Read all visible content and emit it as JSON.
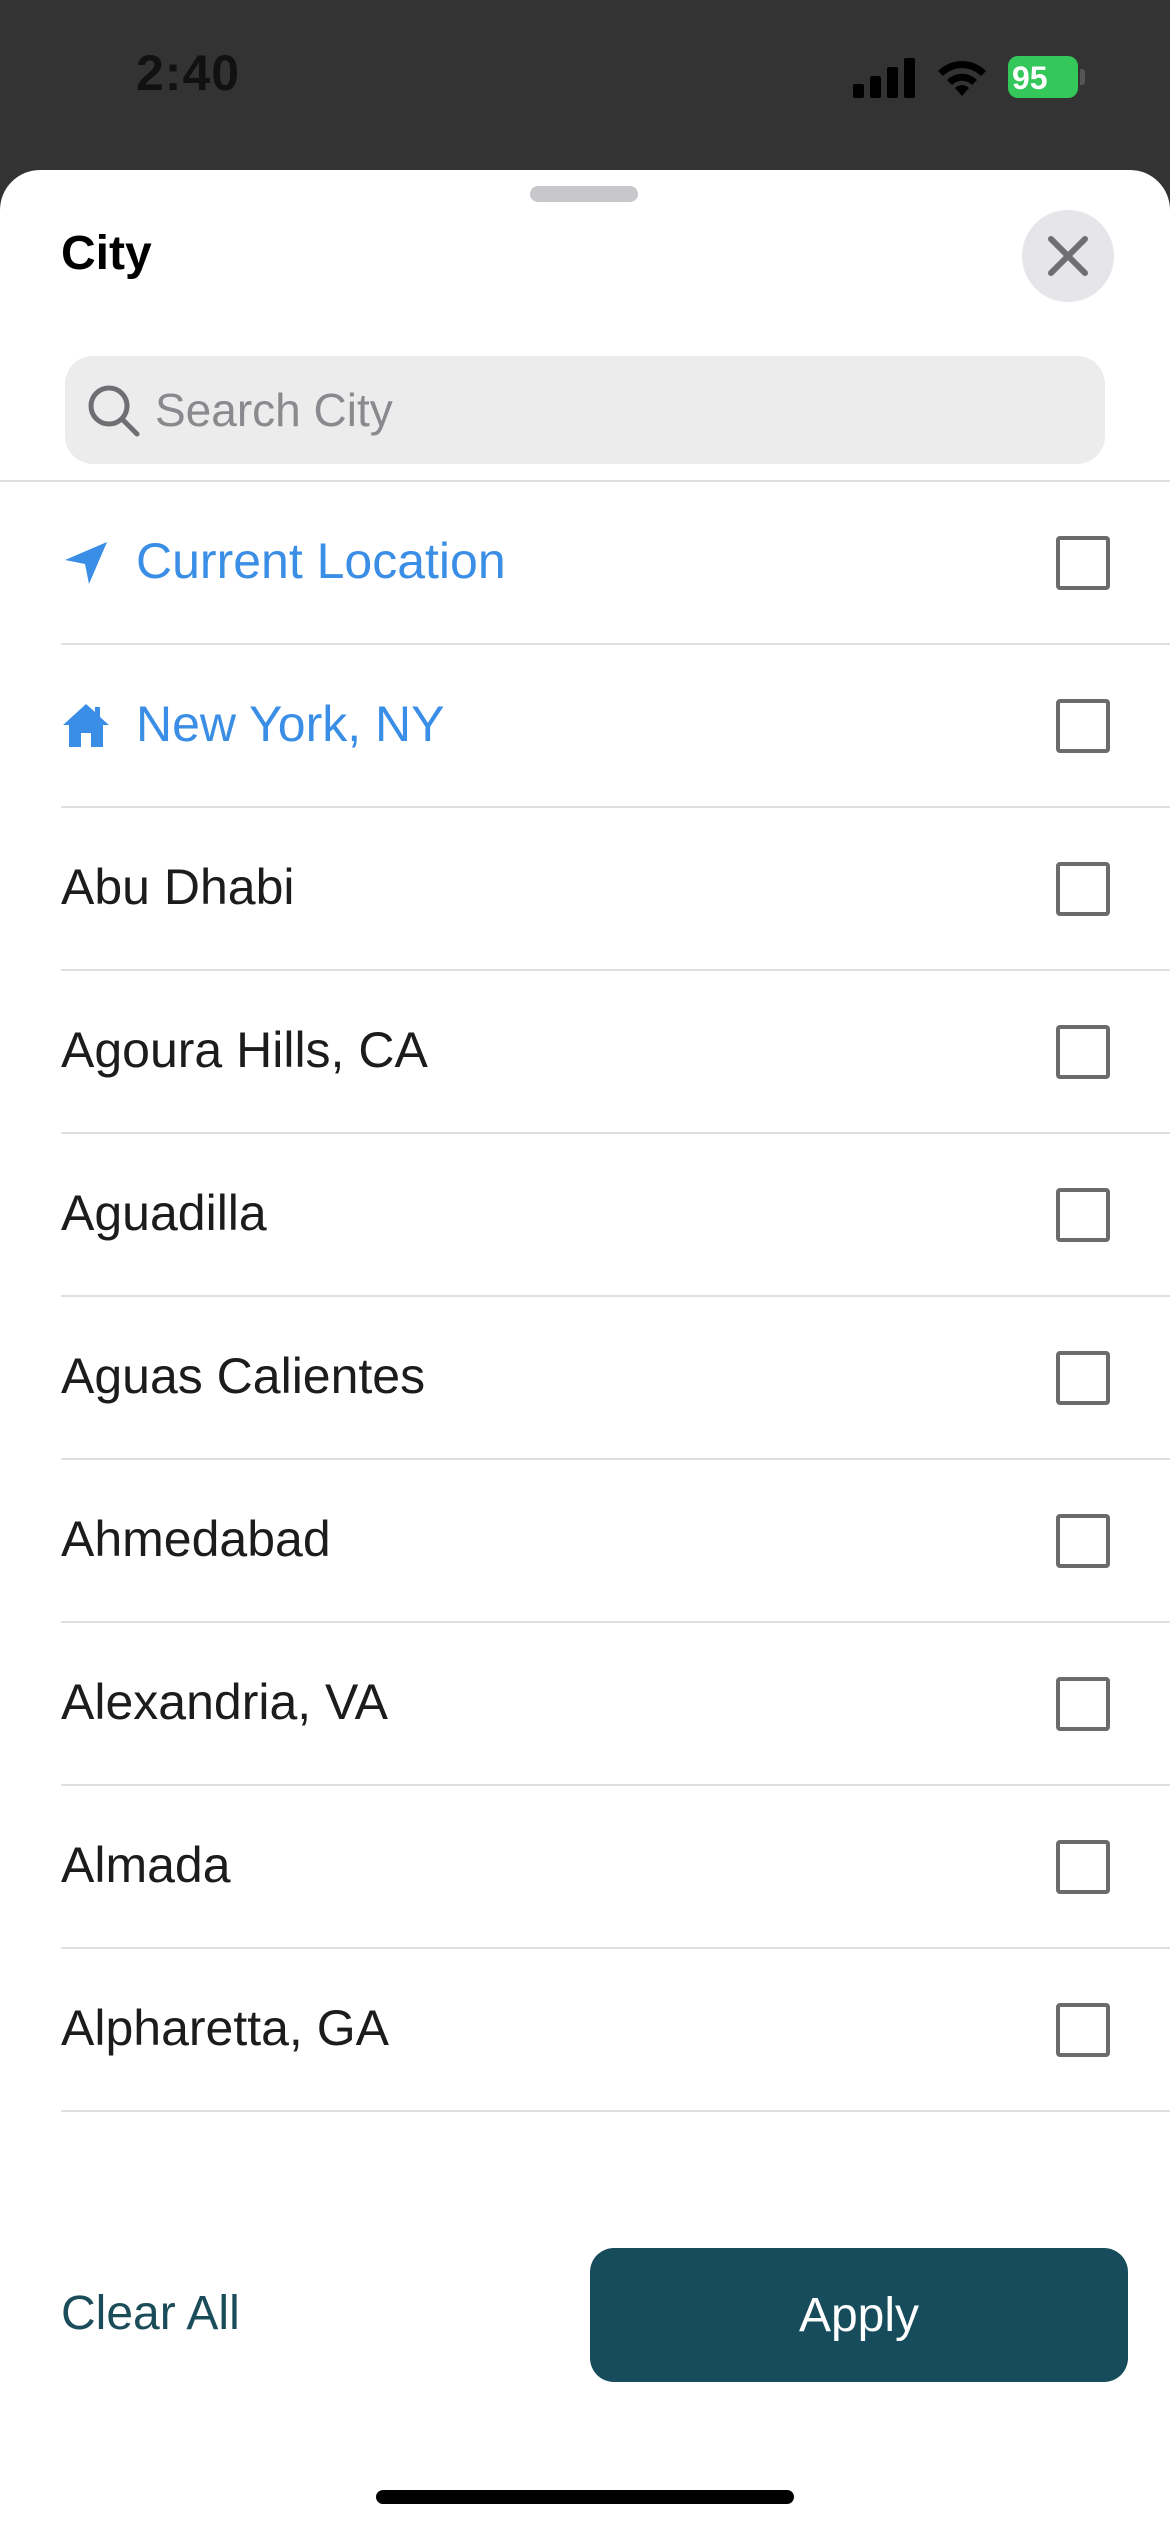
{
  "status_bar": {
    "time": "2:40",
    "battery_level": "95",
    "icons": [
      "signal-icon",
      "wifi-icon",
      "battery-charging-icon"
    ]
  },
  "sheet": {
    "title": "City",
    "close_icon": "close-icon"
  },
  "search": {
    "placeholder": "Search City",
    "value": "",
    "icon": "search-icon"
  },
  "list": {
    "items": [
      {
        "label": "Current Location",
        "icon": "location-arrow-icon",
        "checked": false,
        "accent": "#3a8ee6"
      },
      {
        "label": "New York, NY",
        "icon": "home-icon",
        "checked": false,
        "accent": "#3a8ee6"
      },
      {
        "label": "Abu Dhabi",
        "checked": false
      },
      {
        "label": "Agoura Hills, CA",
        "checked": false
      },
      {
        "label": "Aguadilla",
        "checked": false
      },
      {
        "label": "Aguas Calientes",
        "checked": false
      },
      {
        "label": "Ahmedabad",
        "checked": false
      },
      {
        "label": "Alexandria, VA",
        "checked": false
      },
      {
        "label": "Almada",
        "checked": false
      },
      {
        "label": "Alpharetta, GA",
        "checked": false
      }
    ]
  },
  "footer": {
    "clear_all_label": "Clear All",
    "apply_label": "Apply"
  },
  "colors": {
    "accent_blue": "#3a8ee6",
    "primary_teal": "#164c5b",
    "battery_green": "#34c759"
  }
}
